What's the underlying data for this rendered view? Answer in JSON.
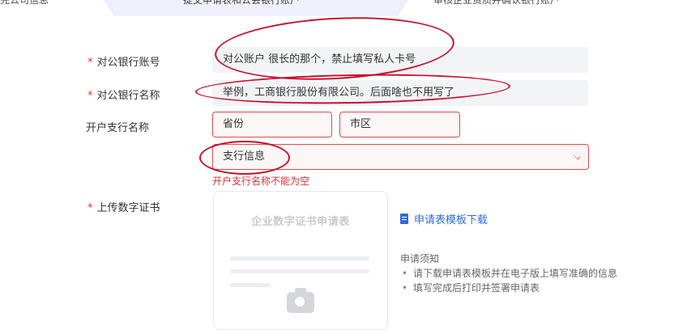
{
  "steps": {
    "step1": "完公司信息",
    "step2": "提交申请表和公会银行账户",
    "step3": "审核企业资质并确认银行账户"
  },
  "form": {
    "account_number": {
      "label": "对公银行账号",
      "value": "对公账户 很长的那个，禁止填写私人卡号"
    },
    "account_name": {
      "label": "对公银行名称",
      "value": "举例，工商银行股份有限公司。后面啥也不用写了"
    },
    "branch": {
      "label": "开户支行名称",
      "province": "省份",
      "city": "市区",
      "branch_info": "支行信息",
      "error": "开户支行名称不能为空"
    },
    "certificate": {
      "label": "上传数字证书",
      "card_title": "企业数字证书申请表",
      "download_link": "申请表模板下载",
      "notes_title": "申请须知",
      "notes": [
        "请下载申请表模板并在电子版上填写准确的信息",
        "填写完成后打印并签署申请表"
      ]
    }
  },
  "colors": {
    "required_star": "#e0303a",
    "error": "#e24b4b",
    "link": "#2f6bd8",
    "annotation": "#c8102e"
  }
}
